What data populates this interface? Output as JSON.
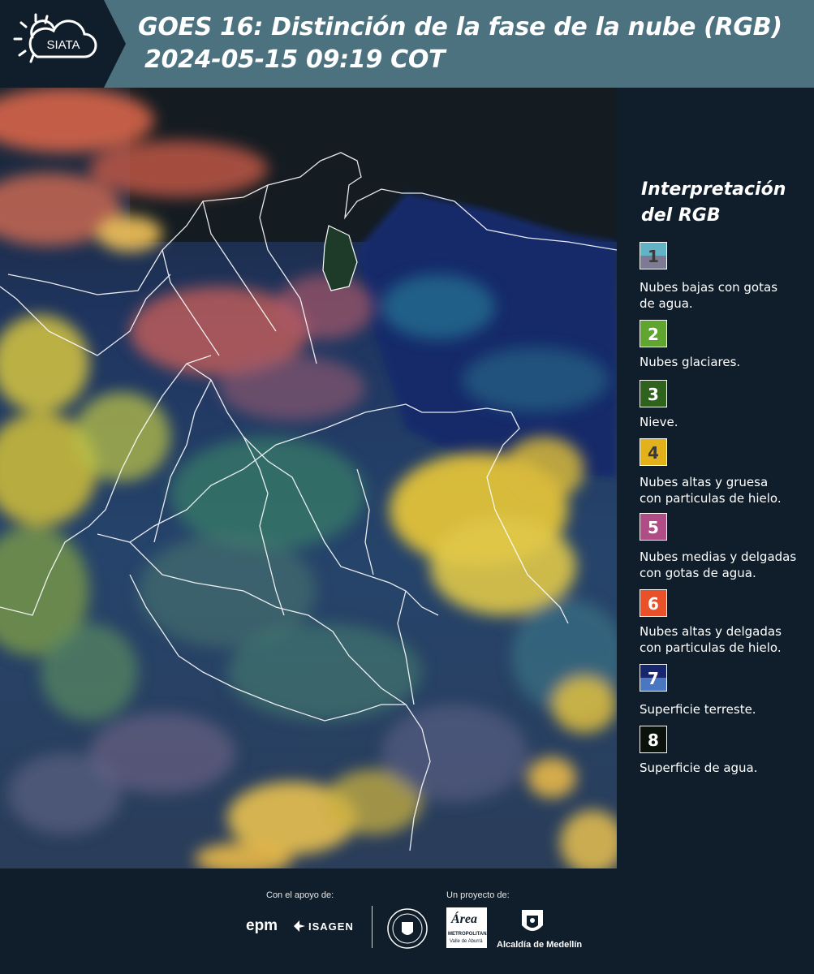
{
  "header": {
    "logo_text": "SIATA",
    "title_line1": "GOES 16: Distinción de la fase de la nube (RGB)",
    "title_line2": "2024-05-15 09:19 COT"
  },
  "legend": {
    "title_line1": "Interpretación",
    "title_line2": "del RGB",
    "items": [
      {
        "number": "1",
        "label_lines": [
          "Nubes bajas con gotas",
          "de agua."
        ],
        "colors": [
          "#63b3c6",
          "#7d7b94"
        ],
        "text_color": "#3a3a3a"
      },
      {
        "number": "2",
        "label_lines": [
          "Nubes glaciares."
        ],
        "colors": [
          "#5fa530"
        ],
        "text_color": "#ffffff"
      },
      {
        "number": "3",
        "label_lines": [
          "Nieve."
        ],
        "colors": [
          "#2f621d"
        ],
        "text_color": "#ffffff"
      },
      {
        "number": "4",
        "label_lines": [
          "Nubes altas y gruesa",
          "con particulas de hielo."
        ],
        "colors": [
          "#e3b21a"
        ],
        "text_color": "#3a3a3a"
      },
      {
        "number": "5",
        "label_lines": [
          "Nubes medias y delgadas",
          "con gotas de agua."
        ],
        "colors": [
          "#b04c86"
        ],
        "text_color": "#ffffff"
      },
      {
        "number": "6",
        "label_lines": [
          "Nubes altas y delgadas",
          "con particulas de hielo."
        ],
        "colors": [
          "#e8512a"
        ],
        "text_color": "#ffffff"
      },
      {
        "number": "7",
        "label_lines": [
          "Superficie terreste."
        ],
        "colors": [
          "#16276e",
          "#4a76c2"
        ],
        "text_color": "#ffffff"
      },
      {
        "number": "8",
        "label_lines": [
          "Superficie de agua."
        ],
        "colors": [
          "#0b120c"
        ],
        "text_color": "#ffffff"
      }
    ]
  },
  "footer": {
    "support_label": "Con el apoyo de:",
    "project_label": "Un proyecto de:",
    "epm": "epm",
    "isagen": "ISAGEN",
    "area_name": "Área",
    "area_sub1": "METROPOLITANA",
    "area_sub2": "Valle de Aburrá",
    "alcaldia": "Alcaldía de Medellín"
  }
}
